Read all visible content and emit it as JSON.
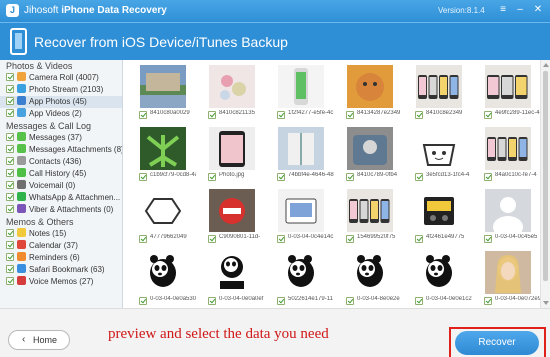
{
  "app": {
    "brand_a": "Jihosoft",
    "brand_b": "iPhone Data Recovery",
    "version": "Version:8.1.4"
  },
  "window_controls": {
    "menu": "≡",
    "minimize": "–",
    "close": "✕"
  },
  "header": {
    "title": "Recover from iOS Device/iTunes Backup"
  },
  "sidebar": {
    "groups": [
      {
        "title": "Photos & Videos",
        "items": [
          {
            "label": "Camera Roll (4007)",
            "icon": "camera-roll-icon",
            "color": "#f0a23b"
          },
          {
            "label": "Photo Stream (2103)",
            "icon": "photo-stream-icon",
            "color": "#3aa0e0"
          },
          {
            "label": "App Photos (45)",
            "icon": "app-photos-icon",
            "color": "#3c7fd1",
            "active": true
          },
          {
            "label": "App Videos (2)",
            "icon": "app-videos-icon",
            "color": "#4aa3df"
          }
        ]
      },
      {
        "title": "Messages & Call Log",
        "items": [
          {
            "label": "Messages (37)",
            "icon": "messages-icon",
            "color": "#57c14a"
          },
          {
            "label": "Messages Attachments (8)",
            "icon": "attachments-icon",
            "color": "#57c14a"
          },
          {
            "label": "Contacts (436)",
            "icon": "contacts-icon",
            "color": "#9a9a9a"
          },
          {
            "label": "Call History (45)",
            "icon": "call-history-icon",
            "color": "#4fbf45"
          },
          {
            "label": "Voicemail (0)",
            "icon": "voicemail-icon",
            "color": "#6f6f6f"
          },
          {
            "label": "WhatsApp & Attachmen...",
            "icon": "whatsapp-icon",
            "color": "#2fb34a"
          },
          {
            "label": "Viber & Attachments (0)",
            "icon": "viber-icon",
            "color": "#7b55b8"
          }
        ]
      },
      {
        "title": "Memos & Others",
        "items": [
          {
            "label": "Notes (15)",
            "icon": "notes-icon",
            "color": "#f2c93a"
          },
          {
            "label": "Calendar (37)",
            "icon": "calendar-icon",
            "color": "#e0463a"
          },
          {
            "label": "Reminders (6)",
            "icon": "reminders-icon",
            "color": "#f08a2e"
          },
          {
            "label": "Safari Bookmark (63)",
            "icon": "safari-icon",
            "color": "#3a8fe0"
          },
          {
            "label": "Voice Memos (27)",
            "icon": "voice-memos-icon",
            "color": "#d63c3c"
          }
        ]
      }
    ]
  },
  "photos": [
    [
      "8410c80a0029",
      "8410c821135",
      "1f2f4277-e5fe-4c",
      "84134287e2349",
      "8410c8e2349",
      "4e9fc289-11ec-4"
    ],
    [
      "c1b9cf79-0cd8-4a",
      "Photo.jpg",
      "74bbf4e-4646-48",
      "8410c789-0fb4",
      "3e5fcd13-1fc4-4",
      "84a0c10c-fe7-4"
    ],
    [
      "47779662049",
      "C9090801-11d-",
      "0-03-04-0c4e14c",
      "154699520f75",
      "4f2461e49775",
      "0-03-04-0c45e5"
    ],
    [
      "0-03-04-0e0a530",
      "0-03-04-0e0a0ef",
      "5022614e179-11",
      "0-03-04-8e0e2e",
      "0-03-04-0e0e1c2",
      "0-03-04-0e072e9"
    ]
  ],
  "footer": {
    "home_arrow": "‹",
    "home_label": "Home",
    "hint": "preview and select the data you need",
    "recover_label": "Recover"
  }
}
